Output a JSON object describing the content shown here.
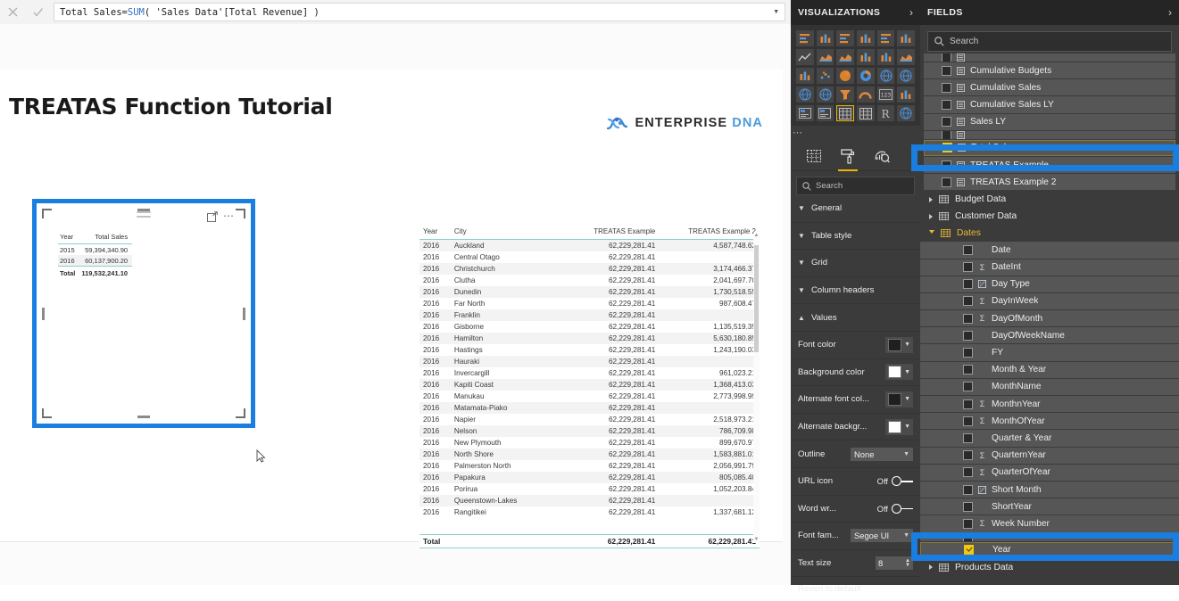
{
  "formula_bar": {
    "cancel_icon": "close-icon",
    "accept_icon": "check-icon",
    "measure_name": "Total Sales",
    "equals": " = ",
    "function": "SUM",
    "expression_rest": "( 'Sales Data'[Total Revenue] )",
    "full_expression": "Total Sales = SUM( 'Sales Data'[Total Revenue] )",
    "expand_icon": "chevron-down-icon"
  },
  "report": {
    "title": "TREATAS Function Tutorial",
    "logo": {
      "word1": "ENTERPRISE",
      "word2": "DNA",
      "icon": "dna-helix-icon"
    }
  },
  "selected_visual": {
    "header_icons": [
      "hamburger-icon",
      "focus-mode-icon",
      "more-options-icon"
    ],
    "table": {
      "columns": [
        "Year",
        "Total Sales"
      ],
      "rows": [
        [
          "2015",
          "59,394,340.90"
        ],
        [
          "2016",
          "60,137,900.20"
        ]
      ],
      "total_row": [
        "Total",
        "119,532,241.10"
      ]
    }
  },
  "main_table": {
    "columns": [
      "Year",
      "City",
      "TREATAS Example",
      "TREATAS Example 2"
    ],
    "rows": [
      [
        "2016",
        "Auckland",
        "62,229,281.41",
        "4,587,748.62"
      ],
      [
        "2016",
        "Central Otago",
        "62,229,281.41",
        ""
      ],
      [
        "2016",
        "Christchurch",
        "62,229,281.41",
        "3,174,466.37"
      ],
      [
        "2016",
        "Clutha",
        "62,229,281.41",
        "2,041,697.70"
      ],
      [
        "2016",
        "Dunedin",
        "62,229,281.41",
        "1,730,518.55"
      ],
      [
        "2016",
        "Far North",
        "62,229,281.41",
        "987,608.47"
      ],
      [
        "2016",
        "Franklin",
        "62,229,281.41",
        ""
      ],
      [
        "2016",
        "Gisborne",
        "62,229,281.41",
        "1,135,519.35"
      ],
      [
        "2016",
        "Hamilton",
        "62,229,281.41",
        "5,630,180.85"
      ],
      [
        "2016",
        "Hastings",
        "62,229,281.41",
        "1,243,190.03"
      ],
      [
        "2016",
        "Hauraki",
        "62,229,281.41",
        ""
      ],
      [
        "2016",
        "Invercargill",
        "62,229,281.41",
        "961,023.21"
      ],
      [
        "2016",
        "Kapiti Coast",
        "62,229,281.41",
        "1,368,413.03"
      ],
      [
        "2016",
        "Manukau",
        "62,229,281.41",
        "2,773,998.99"
      ],
      [
        "2016",
        "Matamata-Piako",
        "62,229,281.41",
        ""
      ],
      [
        "2016",
        "Napier",
        "62,229,281.41",
        "2,518,973.21"
      ],
      [
        "2016",
        "Nelson",
        "62,229,281.41",
        "786,709.98"
      ],
      [
        "2016",
        "New Plymouth",
        "62,229,281.41",
        "899,670.97"
      ],
      [
        "2016",
        "North Shore",
        "62,229,281.41",
        "1,583,881.01"
      ],
      [
        "2016",
        "Palmerston North",
        "62,229,281.41",
        "2,056,991.79"
      ],
      [
        "2016",
        "Papakura",
        "62,229,281.41",
        "805,085.40"
      ],
      [
        "2016",
        "Porirua",
        "62,229,281.41",
        "1,052,203.84"
      ],
      [
        "2016",
        "Queenstown-Lakes",
        "62,229,281.41",
        ""
      ],
      [
        "2016",
        "Rangitikei",
        "62,229,281.41",
        "1,337,681.12"
      ]
    ],
    "total_row": [
      "Total",
      "",
      "62,229,281.41",
      "62,229,281.41"
    ],
    "scrollbar": {
      "up_arrow": "caret-up-icon",
      "down_arrow": "caret-down-icon"
    }
  },
  "visualizations": {
    "title": "VISUALIZATIONS",
    "collapse_icon": "chevron-right-icon",
    "gallery_icons": [
      [
        "stacked-bar-chart-icon",
        "stacked-column-chart-icon",
        "clustered-bar-chart-icon",
        "clustered-column-chart-icon",
        "100-stacked-bar-chart-icon",
        "100-stacked-column-chart-icon"
      ],
      [
        "line-chart-icon",
        "area-chart-icon",
        "stacked-area-chart-icon",
        "line-stacked-column-chart-icon",
        "line-clustered-column-chart-icon",
        "ribbon-chart-icon"
      ],
      [
        "waterfall-chart-icon",
        "scatter-chart-icon",
        "pie-chart-icon",
        "donut-chart-icon",
        "treemap-icon",
        "map-icon"
      ],
      [
        "filled-map-icon",
        "shape-map-icon",
        "funnel-icon",
        "gauge-icon",
        "card-icon",
        "multi-row-card-icon"
      ],
      [
        "kpi-icon",
        "slicer-icon",
        "table-icon",
        "matrix-icon",
        "r-script-visual-icon",
        "python-visual-icon"
      ]
    ],
    "selected_visual_icon": "table-icon",
    "more_icon": "ellipsis-icon",
    "tabs": [
      {
        "name": "fields-tab",
        "icon": "fields-grid-icon",
        "active": false
      },
      {
        "name": "format-tab",
        "icon": "paint-roller-icon",
        "active": true
      },
      {
        "name": "analytics-tab",
        "icon": "analytics-magnifier-icon",
        "active": false
      }
    ],
    "search_placeholder": "Search",
    "search_icon": "search-icon",
    "sections": [
      {
        "label": "General",
        "state": "collapsed",
        "icon": "chevron-down-icon"
      },
      {
        "label": "Table style",
        "state": "collapsed",
        "icon": "chevron-down-icon"
      },
      {
        "label": "Grid",
        "state": "collapsed",
        "icon": "chevron-down-icon"
      },
      {
        "label": "Column headers",
        "state": "collapsed",
        "icon": "chevron-down-icon"
      },
      {
        "label": "Values",
        "state": "expanded",
        "icon": "chevron-up-icon"
      }
    ],
    "value_settings": [
      {
        "label": "Font color",
        "type": "color",
        "color": "#1f1f1f"
      },
      {
        "label": "Background color",
        "type": "color",
        "color": "#ffffff"
      },
      {
        "label": "Alternate font col...",
        "type": "color",
        "color": "#1f1f1f"
      },
      {
        "label": "Alternate backgr...",
        "type": "color",
        "color": "#ffffff"
      }
    ],
    "outline": {
      "label": "Outline",
      "value": "None"
    },
    "url_icon": {
      "label": "URL icon",
      "value": "Off"
    },
    "word_wrap": {
      "label": "Word wr...",
      "value": "Off"
    },
    "font_family": {
      "label": "Font fam...",
      "value": "Segoe UI"
    },
    "text_size": {
      "label": "Text size",
      "value": "8"
    },
    "revert_label": "Revert to default"
  },
  "fields": {
    "title": "FIELDS",
    "collapse_icon": "chevron-right-icon",
    "search_placeholder": "Search",
    "search_icon": "search-icon",
    "items": [
      {
        "label": "",
        "kind": "measure",
        "checked": false,
        "partial": true
      },
      {
        "label": "Cumulative Budgets",
        "kind": "measure",
        "checked": false
      },
      {
        "label": "Cumulative Sales",
        "kind": "measure",
        "checked": false
      },
      {
        "label": "Cumulative Sales LY",
        "kind": "measure",
        "checked": false
      },
      {
        "label": "Sales LY",
        "kind": "measure",
        "checked": false
      },
      {
        "label": "",
        "kind": "measure",
        "checked": false,
        "partial": true
      },
      {
        "label": "Total Sales",
        "kind": "measure",
        "checked": true,
        "highlighted": true
      },
      {
        "label": "TREATAS Example",
        "kind": "measure",
        "checked": false
      },
      {
        "label": "TREATAS Example 2",
        "kind": "measure",
        "checked": false
      },
      {
        "label": "Budget Data",
        "kind": "table",
        "expanded": false
      },
      {
        "label": "Customer Data",
        "kind": "table",
        "expanded": false
      },
      {
        "label": "Dates",
        "kind": "table",
        "expanded": true
      },
      {
        "label": "Date",
        "kind": "field",
        "checked": false,
        "agg": ""
      },
      {
        "label": "DateInt",
        "kind": "field",
        "checked": false,
        "agg": "sigma"
      },
      {
        "label": "Day Type",
        "kind": "field",
        "checked": false,
        "agg": "calc"
      },
      {
        "label": "DayInWeek",
        "kind": "field",
        "checked": false,
        "agg": "sigma"
      },
      {
        "label": "DayOfMonth",
        "kind": "field",
        "checked": false,
        "agg": "sigma"
      },
      {
        "label": "DayOfWeekName",
        "kind": "field",
        "checked": false,
        "agg": ""
      },
      {
        "label": "FY",
        "kind": "field",
        "checked": false,
        "agg": ""
      },
      {
        "label": "Month & Year",
        "kind": "field",
        "checked": false,
        "agg": ""
      },
      {
        "label": "MonthName",
        "kind": "field",
        "checked": false,
        "agg": ""
      },
      {
        "label": "MonthnYear",
        "kind": "field",
        "checked": false,
        "agg": "sigma"
      },
      {
        "label": "MonthOfYear",
        "kind": "field",
        "checked": false,
        "agg": "sigma"
      },
      {
        "label": "Quarter & Year",
        "kind": "field",
        "checked": false,
        "agg": ""
      },
      {
        "label": "QuarternYear",
        "kind": "field",
        "checked": false,
        "agg": "sigma"
      },
      {
        "label": "QuarterOfYear",
        "kind": "field",
        "checked": false,
        "agg": "sigma"
      },
      {
        "label": "Short Month",
        "kind": "field",
        "checked": false,
        "agg": "calc"
      },
      {
        "label": "ShortYear",
        "kind": "field",
        "checked": false,
        "agg": ""
      },
      {
        "label": "Week Number",
        "kind": "field",
        "checked": false,
        "agg": "sigma"
      },
      {
        "label": "",
        "kind": "field",
        "checked": false,
        "partial": true
      },
      {
        "label": "Year",
        "kind": "field",
        "checked": true,
        "highlighted": true
      },
      {
        "label": "Products Data",
        "kind": "table",
        "expanded": false
      }
    ]
  },
  "annotations": {
    "highlight_color": "#1a7ee0",
    "boxes": [
      "selected-table-visual",
      "total-sales-field",
      "year-field"
    ]
  }
}
